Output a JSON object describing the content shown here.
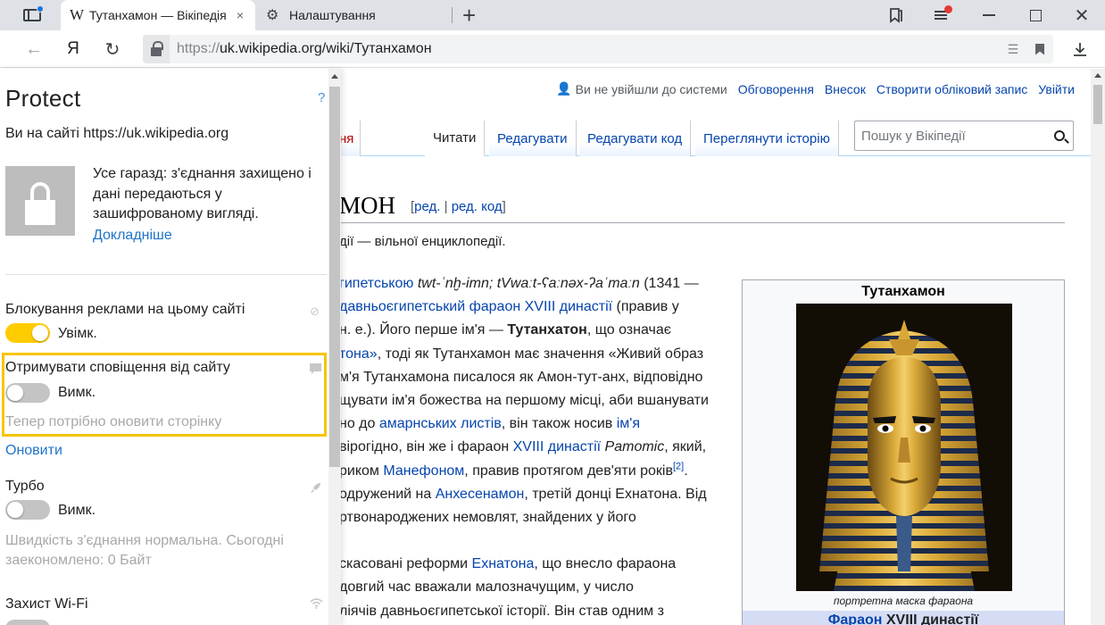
{
  "browser": {
    "tabs": [
      {
        "title": "Тутанхамон — Вікіпедія",
        "favicon": "W",
        "close": "×"
      },
      {
        "title": "Налаштування"
      }
    ],
    "new_tab_glyph": "+",
    "url_scheme": "https://",
    "url_rest": "uk.wikipedia.org/wiki/Тутанхамон",
    "ya_label": "Я"
  },
  "protect": {
    "logo": "Protect",
    "help": "?",
    "site_line": "Ви на сайті https://uk.wikipedia.org",
    "secure_text": "Усе гаразд: з'єднання захищено і дані передаються у зашифрованому вигляді.",
    "more_link": "Докладніше",
    "ads": {
      "label": "Блокування реклами на цьому сайті",
      "state": "Увімк.",
      "on": true
    },
    "notifications": {
      "label": "Отримувати сповіщення від сайту",
      "state": "Вимк.",
      "on": false,
      "hint": "Тепер потрібно оновити сторінку"
    },
    "refresh_link": "Оновити",
    "turbo": {
      "label": "Турбо",
      "state": "Вимк.",
      "on": false,
      "hint_line1": "Швидкість з'єднання нормальна. Сьогодні",
      "hint_line2": "заекономлено: 0 Байт"
    },
    "wifi": {
      "label": "Захист Wi-Fi"
    }
  },
  "wiki": {
    "header_links": {
      "not_logged_in": "Ви не увійшли до системи",
      "talk": "Обговорення",
      "contributions": "Внесок",
      "create_account": "Створити обліковий запис",
      "login": "Увійти"
    },
    "tab_left_fragment": "ня",
    "tabs": {
      "read": "Читати",
      "edit": "Редагувати",
      "edit_code": "Редагувати код",
      "history": "Переглянути історію"
    },
    "search_placeholder": "Пошук у Вікіпедії",
    "title_fragment": "МОН",
    "title_edit": {
      "open": "[",
      "edit": "ред.",
      "sep": " | ",
      "edit_code": "ред. код",
      "close": "]"
    },
    "from_wiki": "дії — вільної енциклопедії.",
    "body": [
      [
        {
          "t": "гипетською",
          "link": true
        },
        {
          "t": " "
        },
        {
          "t": "twt-ʿnḫ-imn; tVwaːt-ʕaːnəx-ʔaˈmaːn",
          "i": true
        },
        {
          "t": " (1341 —"
        }
      ],
      [
        {
          "t": "давньоєгипетський фараон",
          "link": true
        },
        {
          "t": " "
        },
        {
          "t": "XVIII династії",
          "link": true
        },
        {
          "t": " (правив у"
        }
      ],
      [
        {
          "t": "н. е.). Його перше ім'я — "
        },
        {
          "t": "Тутанхатон",
          "b": true
        },
        {
          "t": ", що означає"
        }
      ],
      [
        {
          "t": "тона»",
          "link": true
        },
        {
          "t": ", тоді як Тутанхамон має значення «Живий образ"
        }
      ],
      [
        {
          "t": "м'я Тутанхамона писалося як Амон-тут-анх, відповідно"
        }
      ],
      [
        {
          "t": "щувати ім'я божества на першому місці, аби вшанувати"
        }
      ],
      [
        {
          "t": "но до "
        },
        {
          "t": "амарнських листів",
          "link": true
        },
        {
          "t": ", він також носив "
        },
        {
          "t": "ім'я",
          "link": true
        }
      ],
      [
        {
          "t": "вірогідно, він же і фараон "
        },
        {
          "t": "XVIII династії",
          "link": true
        },
        {
          "t": " "
        },
        {
          "t": "Paтomic",
          "i": true
        },
        {
          "t": ", який,"
        }
      ],
      [
        {
          "t": "риком "
        },
        {
          "t": "Манефоном",
          "link": true
        },
        {
          "t": ", правив протягом дев'яти років"
        },
        {
          "t": "[2]",
          "sup": true
        },
        {
          "t": "."
        }
      ],
      [
        {
          "t": "одружений на "
        },
        {
          "t": "Анхесенамон",
          "link": true
        },
        {
          "t": ", третій донці Ехнатона. Від"
        }
      ],
      [
        {
          "t": "ртвонароджених немовлят, знайдених у його"
        }
      ],
      [],
      [
        {
          "t": "скасовані реформи "
        },
        {
          "t": "Ехнатона",
          "link": true
        },
        {
          "t": ", що внесло фараона"
        }
      ],
      [
        {
          "t": "довгий час вважали малозначущим, у число"
        }
      ],
      [
        {
          "t": "ліячів давньоєгипетської історії. Він став одним з"
        }
      ]
    ],
    "infobox": {
      "title": "Тутанхамон",
      "caption": "портретна маска фараона",
      "pharaoh_link": "Фараон",
      "pharaoh_rest": " XVIII династії"
    }
  }
}
